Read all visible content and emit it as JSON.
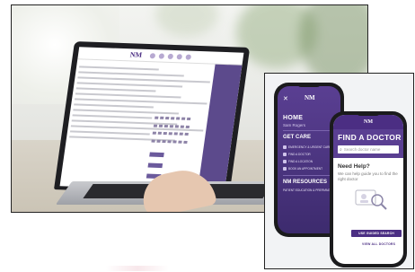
{
  "laptop": {
    "logo": "NM"
  },
  "phone_menu": {
    "close_glyph": "✕",
    "logo": "NM",
    "home_label": "HOME",
    "user_name": "Sam Rogers",
    "sections": [
      {
        "title": "GET CARE",
        "items": [
          "EMERGENCY & URGENT CARE",
          "FIND A DOCTOR",
          "FIND A LOCATION",
          "BOOK AN APPOINTMENT"
        ]
      },
      {
        "title": "NM RESOURCES",
        "items": [
          "PATIENT EDUCATION & PREPARATION"
        ]
      }
    ]
  },
  "phone_find": {
    "logo": "NM",
    "title": "FIND A DOCTOR",
    "search_placeholder": "Search doctor name",
    "help_title": "Need Help?",
    "help_text": "We can help guide you to find the right doctor",
    "advanced_button": "USE GUIDED SEARCH",
    "secondary_link": "VIEW ALL DOCTORS"
  },
  "colors": {
    "brand_purple": "#4b2e83",
    "menu_purple": "#5a3f92"
  }
}
